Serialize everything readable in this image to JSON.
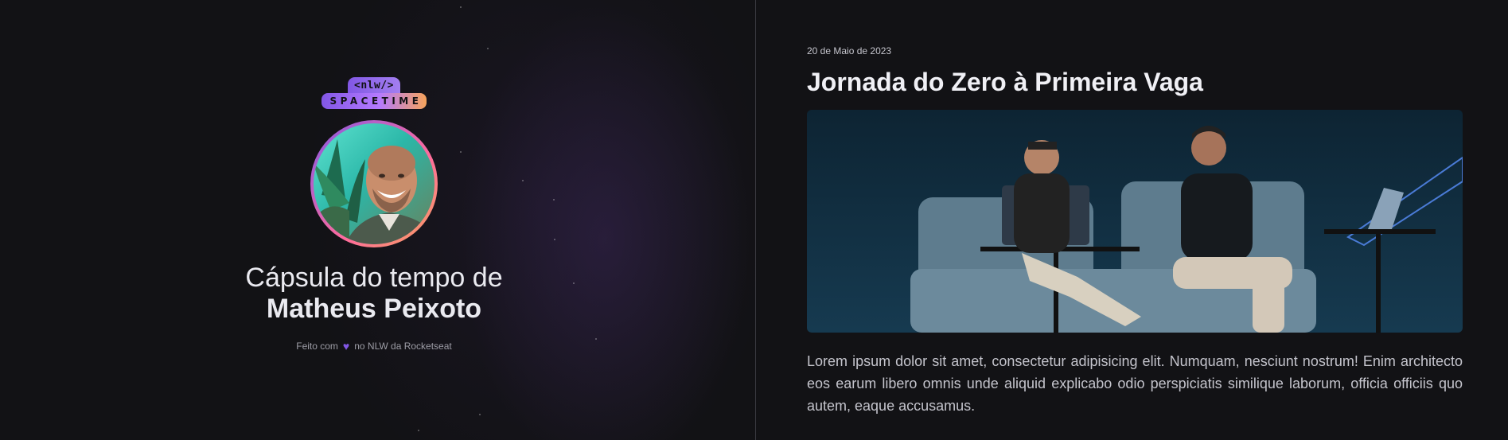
{
  "brand": {
    "tag": "<nlw/>",
    "wordmark": "SPACETIME"
  },
  "profile": {
    "heading_line1": "Cápsula do tempo de",
    "name": "Matheus Peixoto",
    "avatar_icon": "person-photo"
  },
  "footer": {
    "prefix": "Feito com",
    "heart_icon": "heart-icon",
    "suffix": "no NLW da Rocketseat"
  },
  "memory": {
    "date": "20 de Maio de 2023",
    "title": "Jornada do Zero à Primeira Vaga",
    "description": "Lorem ipsum dolor sit amet, consectetur adipisicing elit. Numquam, nesciunt nostrum! Enim architecto eos earum libero omnis unde aliquid explicabo odio perspiciatis similique laborum, officia officiis quo autem, eaque accusamus."
  },
  "colors": {
    "background": "#121215",
    "accent_purple": "#8257e5",
    "accent_orange": "#f6a35b",
    "text_muted": "#9d9da6"
  }
}
